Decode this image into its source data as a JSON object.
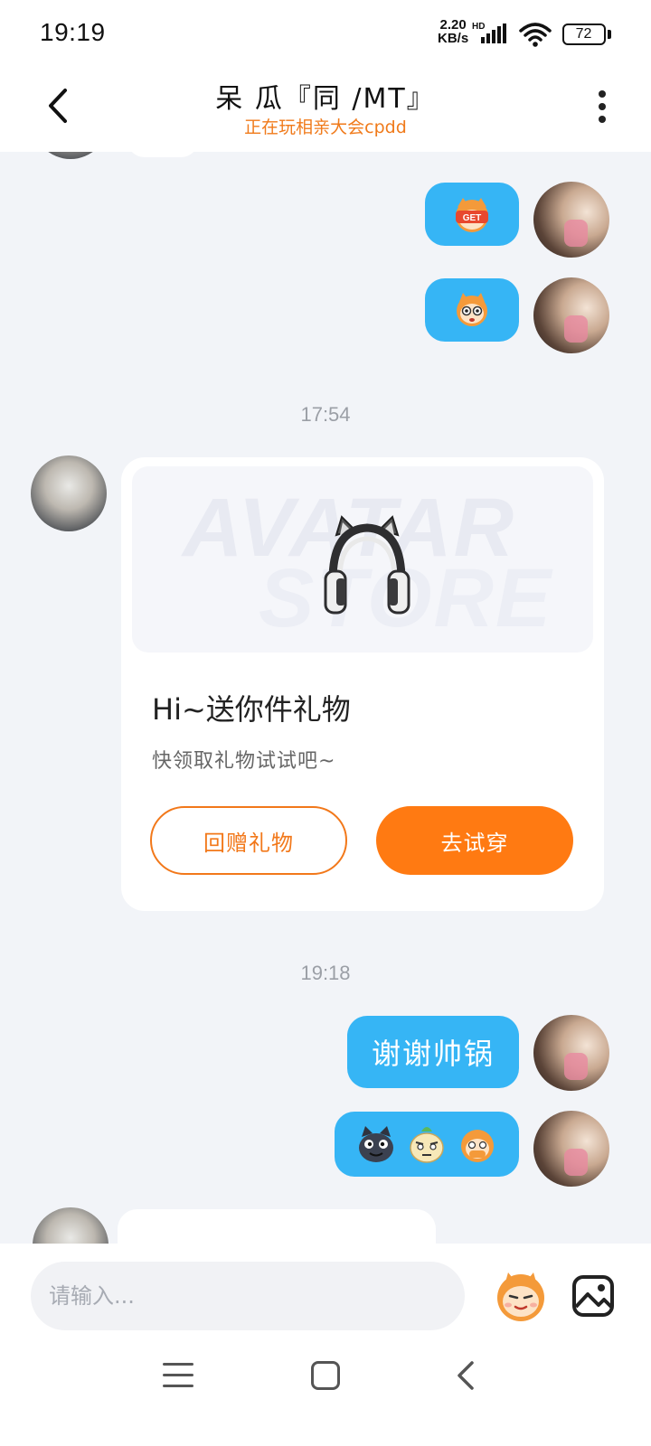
{
  "status_bar": {
    "time": "19:19",
    "net_speed_value": "2.20",
    "net_speed_unit": "KB/s",
    "hd": "HD",
    "battery": "72",
    "icons": [
      "signal-icon",
      "wifi-icon",
      "battery-icon"
    ]
  },
  "header": {
    "title": "呆 瓜『同 /MT』",
    "subtitle": "正在玩相亲大会cpdd",
    "icons": [
      "back-arrow-icon",
      "more-vertical-icon"
    ]
  },
  "messages": {
    "sticker_get": "GET",
    "time_1": "17:54",
    "gift": {
      "banner_line1": "AVATAR",
      "banner_line2": "STORE",
      "title": "Hi~送你件礼物",
      "desc": "快领取礼物试试吧~",
      "return_button": "回赠礼物",
      "try_button": "去试穿"
    },
    "time_2": "19:18",
    "text_1": "谢谢帅锅"
  },
  "input": {
    "placeholder": "请输入..."
  },
  "colors": {
    "bubble_me": "#36b5f5",
    "accent_orange": "#ff7a12",
    "subtitle_orange": "#f07a1a",
    "background": "#f2f4f8"
  }
}
